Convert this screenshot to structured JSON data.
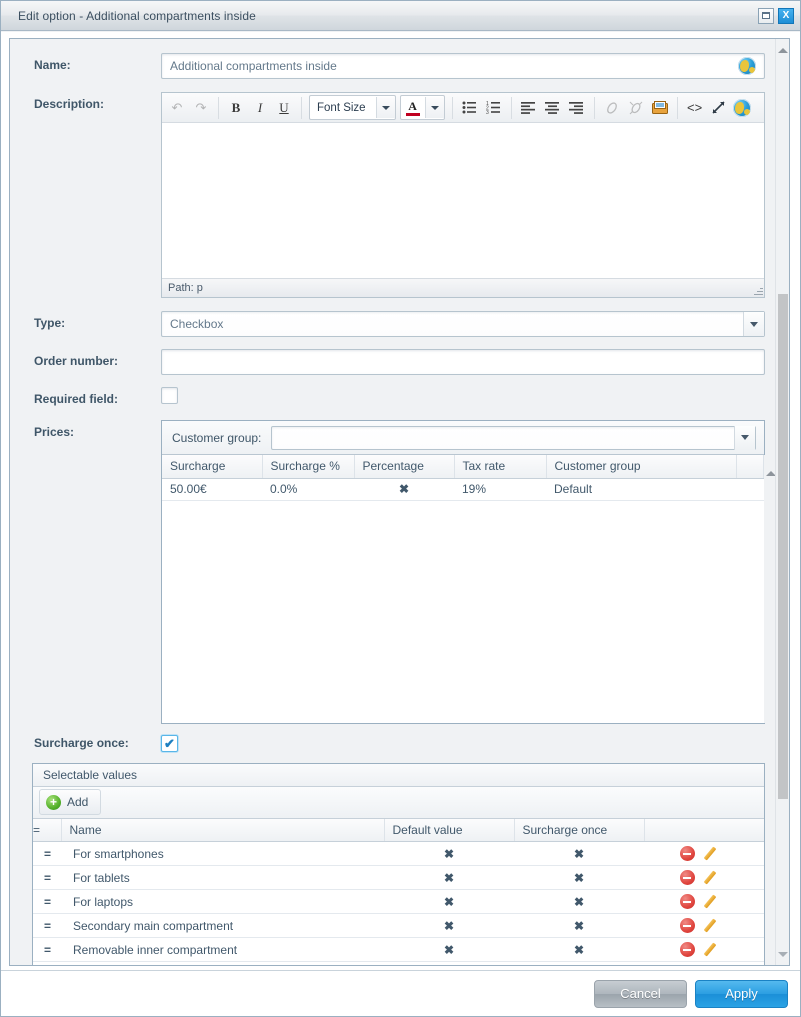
{
  "window": {
    "title": "Edit option - Additional compartments inside",
    "minimize_icon": "minimize-icon",
    "close_label": "X"
  },
  "form": {
    "name": {
      "label": "Name:",
      "value": "Additional compartments inside",
      "globe_icon": "globe-icon"
    },
    "description": {
      "label": "Description:",
      "content": "",
      "status": "Path: p",
      "toolbar": {
        "undo": "↶",
        "redo": "↷",
        "bold": "B",
        "italic": "I",
        "underline": "U",
        "fontsize": "Font Size",
        "forecolor": "A",
        "bullist": "bullet-list-icon",
        "numlist": "numbered-list-icon",
        "align_left": "align-left-icon",
        "align_center": "align-center-icon",
        "align_right": "align-right-icon",
        "link": "link-icon",
        "unlink": "unlink-icon",
        "image": "image-icon",
        "source": "<>",
        "fullscreen": "fullscreen-icon",
        "globe": "globe-icon"
      }
    },
    "type": {
      "label": "Type:",
      "value": "Checkbox"
    },
    "order_number": {
      "label": "Order number:",
      "value": ""
    },
    "required_field": {
      "label": "Required field:",
      "checked": false
    },
    "surcharge_once": {
      "label": "Surcharge once:",
      "checked": true
    },
    "prices": {
      "label": "Prices:"
    }
  },
  "prices_panel": {
    "customer_group_label": "Customer group:",
    "customer_group_value": "",
    "columns": [
      "Surcharge",
      "Surcharge %",
      "Percentage",
      "Tax rate",
      "Customer group",
      ""
    ],
    "rows": [
      {
        "surcharge": "50.00€",
        "surcharge_pct": "0.0%",
        "percentage": "✖",
        "tax_rate": "19%",
        "customer_group": "Default",
        "extra": ""
      }
    ]
  },
  "selectable_values": {
    "header": "Selectable values",
    "add_label": "Add",
    "columns": [
      "=",
      "Name",
      "Default value",
      "Surcharge once",
      ""
    ],
    "rows": [
      {
        "handle": "=",
        "name": "For smartphones",
        "default_value": "✖",
        "surcharge_once": "✖"
      },
      {
        "handle": "=",
        "name": "For tablets",
        "default_value": "✖",
        "surcharge_once": "✖"
      },
      {
        "handle": "=",
        "name": "For laptops",
        "default_value": "✖",
        "surcharge_once": "✖"
      },
      {
        "handle": "=",
        "name": "Secondary main compartment",
        "default_value": "✖",
        "surcharge_once": "✖"
      },
      {
        "handle": "=",
        "name": "Removable inner compartment",
        "default_value": "✖",
        "surcharge_once": "✖"
      }
    ],
    "delete_icon": "delete-icon",
    "edit_icon": "edit-pencil-icon"
  },
  "footer": {
    "cancel": "Cancel",
    "apply": "Apply"
  },
  "colors": {
    "accent": "#1d8ed6",
    "danger": "#cf3b33",
    "title_text": "#3c4f60",
    "label_text": "#3f5668"
  }
}
